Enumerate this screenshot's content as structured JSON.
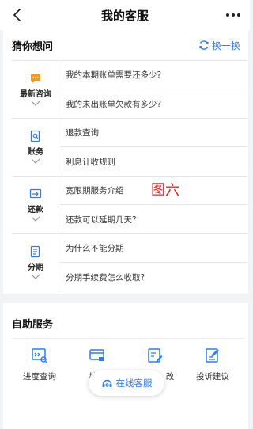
{
  "header": {
    "title": "我的客服",
    "back_icon": "chevron-left-icon",
    "more_icon": "more-dots-icon"
  },
  "faq": {
    "title": "猜你想问",
    "refresh_label": "换一换",
    "groups": [
      {
        "category": "最新咨询",
        "icon": "chat-bubble-icon",
        "questions": [
          "我的本期账单需要还多少?",
          "我的未出账单欠款有多少?"
        ]
      },
      {
        "category": "账务",
        "icon": "document-search-icon",
        "questions": [
          "退款查询",
          "利息计收规则"
        ]
      },
      {
        "category": "还款",
        "icon": "repayment-icon",
        "questions": [
          "宽限期服务介绍",
          "还款可以延期几天?"
        ]
      },
      {
        "category": "分期",
        "icon": "installment-icon",
        "questions": [
          "为什么不能分期",
          "分期手续费怎么收取?"
        ]
      }
    ]
  },
  "overlay_label": "图六",
  "self_service": {
    "title": "自助服务",
    "items": [
      {
        "label": "进度查询",
        "icon": "progress-query-icon"
      },
      {
        "label": "挂失",
        "icon": "card-lock-icon"
      },
      {
        "label": "改",
        "icon": "edit-form-icon"
      },
      {
        "label": "投诉建议",
        "icon": "complaint-icon"
      }
    ]
  },
  "online_service": {
    "label": "在线客服",
    "icon": "headset-icon"
  },
  "colors": {
    "accent": "#2f7bf0",
    "icon_orange": "#f39a1e",
    "overlay_red": "#e82424"
  }
}
